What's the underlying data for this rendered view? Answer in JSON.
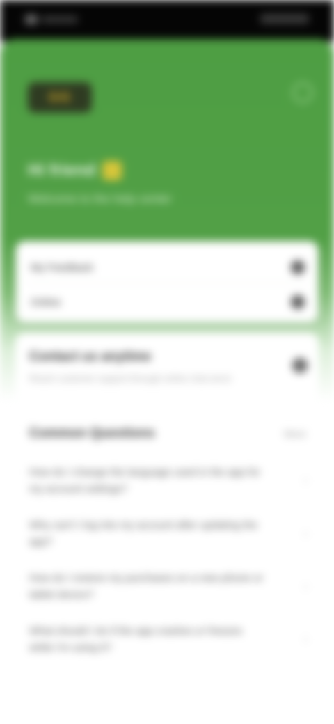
{
  "status_bar": {},
  "header": {
    "logo_text": "GG",
    "greeting": "Hi friend",
    "subtitle": "Welcome to the help center"
  },
  "card": {
    "row1_label": "My Feedback",
    "row2_label": "Online"
  },
  "section1": {
    "title": "Contact us anytime",
    "desc": "Reach customer support through online chat service"
  },
  "faq": {
    "title": "Common Questions",
    "more_label": "More",
    "items": [
      {
        "question": "How do I change the language used in the app for my account settings?"
      },
      {
        "question": "Why can't I log into my account after updating the app?"
      },
      {
        "question": "How do I restore my purchases on a new phone or tablet device?"
      },
      {
        "question": "What should I do if the app crashes or freezes while I'm using it?"
      }
    ]
  },
  "colors": {
    "brand_green": "#52a046"
  }
}
